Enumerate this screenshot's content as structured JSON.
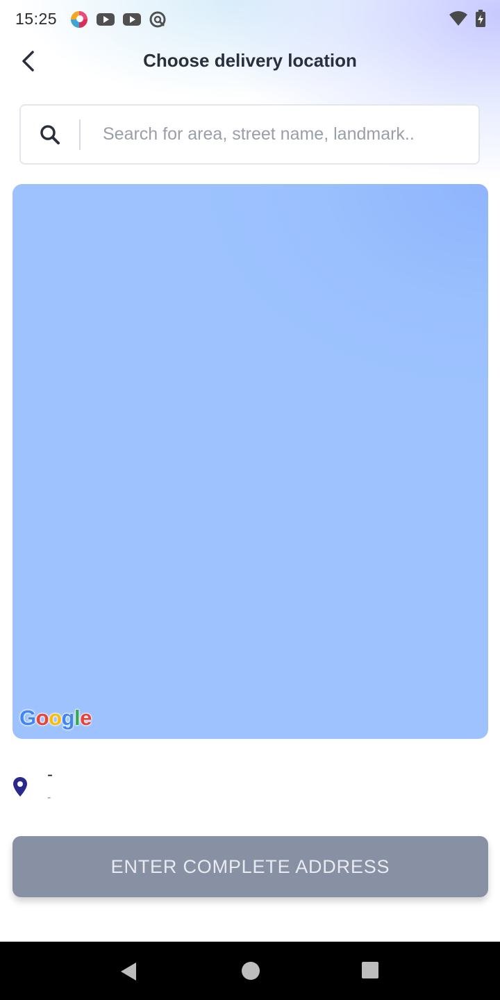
{
  "status_bar": {
    "time": "15:25",
    "left_icons": [
      "app-notification-icon",
      "youtube-icon",
      "youtube-icon",
      "sync-icon"
    ],
    "right_icons": [
      "wifi-icon",
      "battery-charging-icon"
    ]
  },
  "header": {
    "title": "Choose delivery location",
    "back_icon": "chevron-left-icon"
  },
  "search": {
    "placeholder": "Search for area, street name, landmark..",
    "value": ""
  },
  "map": {
    "attribution": "Google",
    "colors": {
      "map_fill": "#9dc2fe"
    }
  },
  "location": {
    "title": "-",
    "subtitle": "-"
  },
  "cta": {
    "label": "ENTER COMPLETE ADDRESS",
    "color": "#8890a4"
  },
  "nav": {
    "icons": [
      "back-triangle-icon",
      "home-circle-icon",
      "recents-square-icon"
    ]
  },
  "colors": {
    "accent_pin": "#2a2a8c",
    "title_text": "#2a2f3c"
  }
}
